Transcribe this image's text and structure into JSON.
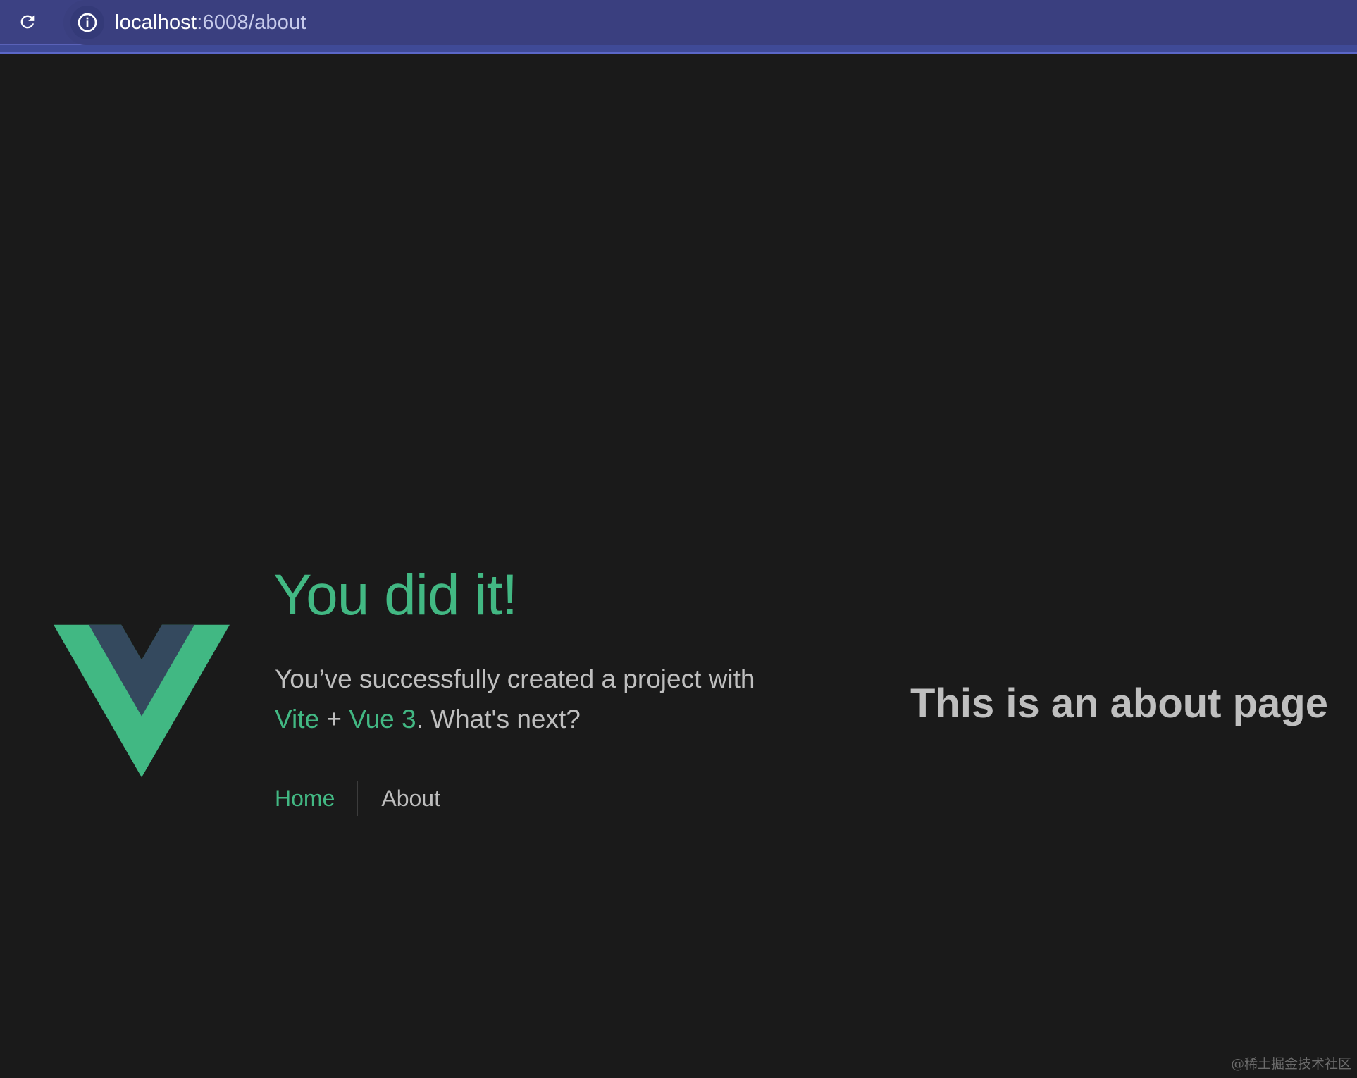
{
  "browser": {
    "url_host": "localhost",
    "url_rest": ":6008/about",
    "icons": {
      "reload": "reload-icon",
      "info": "info-icon"
    }
  },
  "hero": {
    "title": "You did it!",
    "subtitle_prefix": "You’ve successfully created a project with",
    "vite_link": "Vite",
    "plus": " + ",
    "vue_link": "Vue 3",
    "subtitle_suffix": ". What's next?"
  },
  "nav": {
    "home": "Home",
    "about": "About"
  },
  "main": {
    "heading": "This is an about page"
  },
  "watermark": "@稀土掘金技术社区",
  "colors": {
    "background": "#1a1a1a",
    "vue_green": "#42b883",
    "vue_dark": "#35495e",
    "text_muted": "#bfbfbf",
    "browser_bar": "#3c4183"
  }
}
